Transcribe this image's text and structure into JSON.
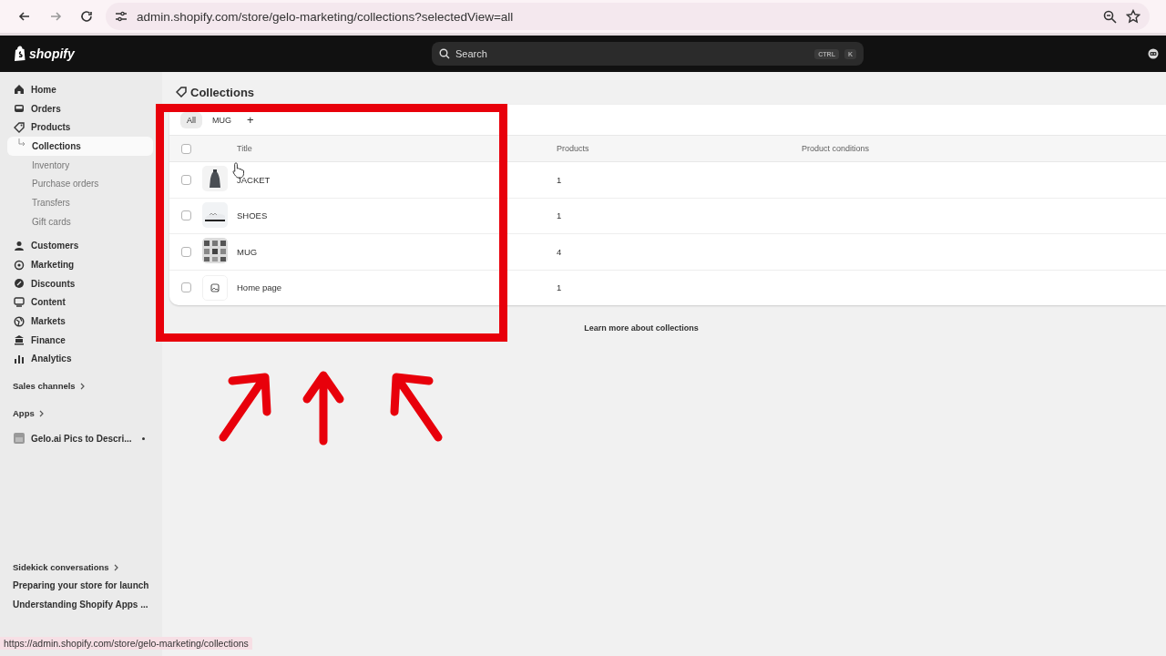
{
  "browser": {
    "url": "admin.shopify.com/store/gelo-marketing/collections?selectedView=all",
    "status_url": "https://admin.shopify.com/store/gelo-marketing/collections"
  },
  "topbar": {
    "logo": "shopify",
    "search": {
      "placeholder": "Search"
    },
    "shortcut": [
      "CTRL",
      "K"
    ]
  },
  "sidebar": {
    "items": [
      {
        "label": "Home",
        "selected": false
      },
      {
        "label": "Orders",
        "selected": false
      },
      {
        "label": "Products",
        "selected": false,
        "children": [
          {
            "label": "Collections",
            "selected": true
          },
          {
            "label": "Inventory",
            "selected": false
          },
          {
            "label": "Purchase orders",
            "selected": false
          },
          {
            "label": "Transfers",
            "selected": false
          },
          {
            "label": "Gift cards",
            "selected": false
          }
        ]
      },
      {
        "label": "Customers",
        "selected": false
      },
      {
        "label": "Marketing",
        "selected": false
      },
      {
        "label": "Discounts",
        "selected": false
      },
      {
        "label": "Content",
        "selected": false
      },
      {
        "label": "Markets",
        "selected": false
      },
      {
        "label": "Finance",
        "selected": false
      },
      {
        "label": "Analytics",
        "selected": false
      }
    ],
    "sales_channels": "Sales channels",
    "apps": "Apps",
    "app_items": [
      {
        "label": "Gelo.ai Pics to Descri...",
        "pinned": true
      }
    ],
    "sidekick": {
      "heading": "Sidekick conversations",
      "items": [
        "Preparing your store for launch",
        "Understanding Shopify Apps ..."
      ]
    }
  },
  "page": {
    "title": "Collections",
    "tabs": [
      {
        "label": "All",
        "selected": true
      },
      {
        "label": "MUG",
        "selected": false
      }
    ],
    "add_tab": "+",
    "columns": [
      "Title",
      "Products",
      "Product conditions"
    ],
    "select_all": {
      "checked": false
    },
    "rows": [
      {
        "title": "JACKET",
        "products": "1",
        "checked": false
      },
      {
        "title": "SHOES",
        "products": "1",
        "checked": false
      },
      {
        "title": "MUG",
        "products": "4",
        "checked": false
      },
      {
        "title": "Home page",
        "products": "1",
        "checked": false,
        "thumb": {
          "kind": "placeholder"
        }
      }
    ],
    "footer_link": "Learn more about collections"
  },
  "annotation": {
    "highlight": true,
    "arrows": [
      {
        "kind": "up-right"
      },
      {
        "kind": "up"
      },
      {
        "kind": "up-left"
      }
    ]
  }
}
